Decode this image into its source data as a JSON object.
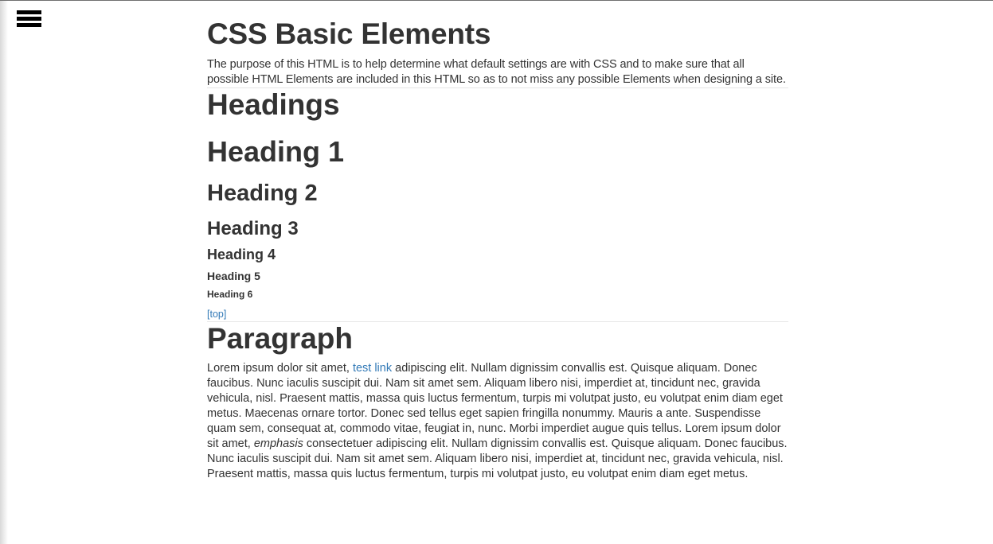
{
  "menu": {
    "icon": "hamburger-menu-icon"
  },
  "page": {
    "title": "CSS Basic Elements",
    "intro": "The purpose of this HTML is to help determine what default settings are with CSS and to make sure that all possible HTML Elements are included in this HTML so as to not miss any possible Elements when designing a site."
  },
  "headings_section": {
    "title": "Headings",
    "h1": "Heading 1",
    "h2": "Heading 2",
    "h3": "Heading 3",
    "h4": "Heading 4",
    "h5": "Heading 5",
    "h6": "Heading 6",
    "top_link": "[top]"
  },
  "paragraph_section": {
    "title": "Paragraph",
    "text_before_link": "Lorem ipsum dolor sit amet, ",
    "link": "test link",
    "text_after_link": " adipiscing elit. Nullam dignissim convallis est. Quisque aliquam. Donec faucibus. Nunc iaculis suscipit dui. Nam sit amet sem. Aliquam libero nisi, imperdiet at, tincidunt nec, gravida vehicula, nisl. Praesent mattis, massa quis luctus fermentum, turpis mi volutpat justo, eu volutpat enim diam eget metus. Maecenas ornare tortor. Donec sed tellus eget sapien fringilla nonummy. Mauris a ante. Suspendisse quam sem, consequat at, commodo vitae, feugiat in, nunc. Morbi imperdiet augue quis tellus. Lorem ipsum dolor sit amet, ",
    "emphasis": "emphasis",
    "text_after_emphasis": " consectetuer adipiscing elit. Nullam dignissim convallis est. Quisque aliquam. Donec faucibus. Nunc iaculis suscipit dui. Nam sit amet sem. Aliquam libero nisi, imperdiet at, tincidunt nec, gravida vehicula, nisl. Praesent mattis, massa quis luctus fermentum, turpis mi volutpat justo, eu volutpat enim diam eget metus."
  },
  "colors": {
    "link": "#337ab7",
    "text": "#333333",
    "divider": "#e6e6e6"
  }
}
